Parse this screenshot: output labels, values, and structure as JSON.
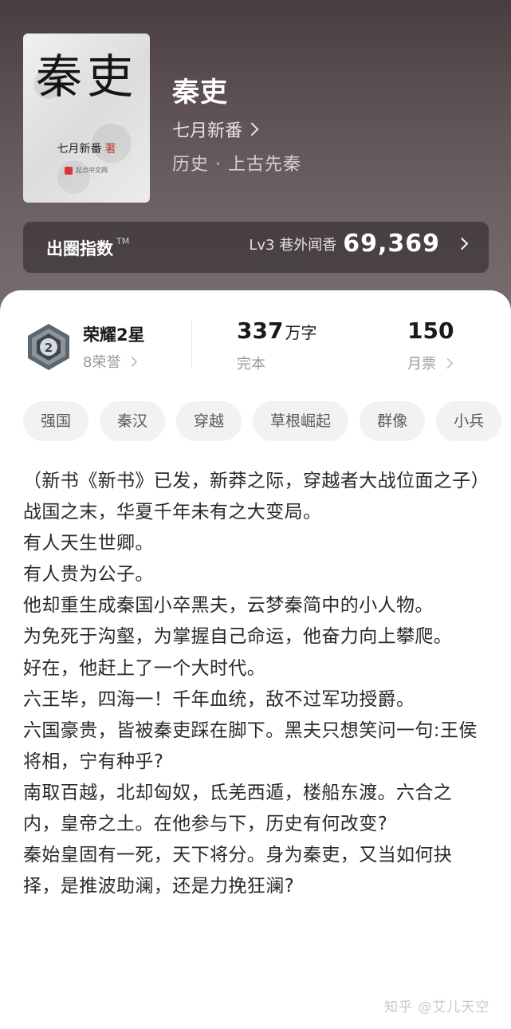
{
  "book": {
    "cover_title": "秦吏",
    "cover_author": "七月新番",
    "cover_author_suffix": "著",
    "cover_publisher": "起点中文网",
    "title": "秦吏",
    "author": "七月新番",
    "category": "历史 · 上古先秦"
  },
  "index": {
    "label": "出圈指数",
    "tm": "TM",
    "level": "Lv3 巷外闻香",
    "value": "69,369"
  },
  "stats": {
    "honor_name": "荣耀2星",
    "honor_count": "8荣誉",
    "badge_number": "2",
    "words_value": "337",
    "words_unit": "万字",
    "status": "完本",
    "monthly_tickets": "150",
    "monthly_label": "月票"
  },
  "tags": [
    "强国",
    "秦汉",
    "穿越",
    "草根崛起",
    "群像",
    "小兵"
  ],
  "intro": [
    "（新书《新书》已发，新莽之际，穿越者大战位面之子）",
    "战国之末，华夏千年未有之大变局。",
    "有人天生世卿。",
    "有人贵为公子。",
    "他却重生成秦国小卒黑夫，云梦秦简中的小人物。",
    "为免死于沟壑，为掌握自己命运，他奋力向上攀爬。",
    "好在，他赶上了一个大时代。",
    "六王毕，四海一！千年血统，敌不过军功授爵。",
    "六国豪贵，皆被秦吏踩在脚下。黑夫只想笑问一句:王侯将相，宁有种乎?",
    "南取百越，北却匈奴，氐羌西遁，楼船东渡。六合之内，皇帝之土。在他参与下，历史有何改变?",
    "秦始皇固有一死，天下将分。身为秦吏，又当如何抉择，是推波助澜，还是力挽狂澜?"
  ],
  "watermark": "知乎 @艾儿天空",
  "colors": {
    "header_bg": "#5c5052",
    "tag_bg": "#f2f2f2",
    "text_dark": "#1a1a1a",
    "text_muted": "#9a9a9a"
  }
}
